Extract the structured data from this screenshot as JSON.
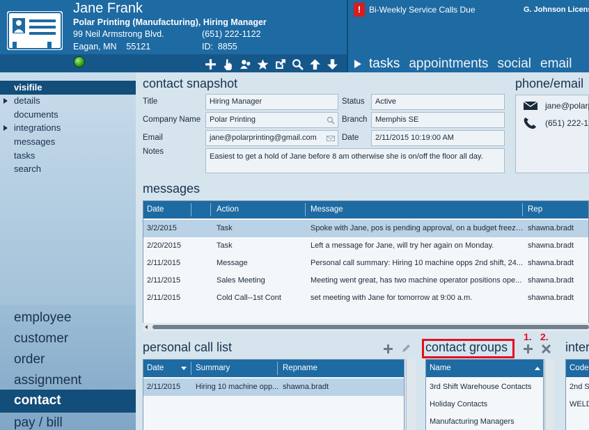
{
  "header": {
    "contact_name": "Jane Frank",
    "company_title": "Polar Printing (Manufacturing), Hiring Manager",
    "address_line1": "99 Neil Armstrong Blvd.",
    "phone": "(651) 222-1122",
    "address_line2": "Eagan, MN    55121",
    "id_text": "ID:  8855",
    "alert_badge": "!",
    "alert_text": "Bi-Weekly Service Calls Due",
    "user_name": "G. Johnson Licens",
    "nav_tabs": [
      "tasks",
      "appointments",
      "social",
      "email"
    ],
    "tool_icons": [
      "plus-icon",
      "pointer-hand-icon",
      "group-add-icon",
      "star-icon",
      "open-external-icon",
      "search-icon",
      "arrow-up-icon",
      "arrow-down-icon"
    ]
  },
  "sidebar": {
    "items": [
      {
        "label": "visifile",
        "active": true,
        "expandable": false
      },
      {
        "label": "details",
        "active": false,
        "expandable": true
      },
      {
        "label": "documents",
        "active": false,
        "expandable": false
      },
      {
        "label": "integrations",
        "active": false,
        "expandable": true
      },
      {
        "label": "messages",
        "active": false,
        "expandable": false
      },
      {
        "label": "tasks",
        "active": false,
        "expandable": false
      },
      {
        "label": "search",
        "active": false,
        "expandable": false
      }
    ],
    "bottom_nav": [
      {
        "label": "employee",
        "active": false
      },
      {
        "label": "customer",
        "active": false
      },
      {
        "label": "order",
        "active": false
      },
      {
        "label": "assignment",
        "active": false
      },
      {
        "label": "contact",
        "active": true
      },
      {
        "label": "pay / bill",
        "active": false
      }
    ]
  },
  "snapshot": {
    "title": "contact snapshot",
    "fields": {
      "title_label": "Title",
      "title_value": "Hiring Manager",
      "company_label": "Company Name",
      "company_value": "Polar Printing",
      "email_label": "Email",
      "email_value": "jane@polarprinting@gmail.com",
      "notes_label": "Notes",
      "notes_value": "Easiest to get a hold of Jane before 8 am otherwise she is on/off the floor all day.",
      "status_label": "Status",
      "status_value": "Active",
      "branch_label": "Branch",
      "branch_value": "Memphis SE",
      "date_label": "Date",
      "date_value": "2/11/2015 10:19:00 AM"
    }
  },
  "phone_email": {
    "title": "phone/email",
    "email": "jane@polarp",
    "phone": "(651) 222-1"
  },
  "messages": {
    "title": "messages",
    "columns": [
      "Date",
      "Action",
      "Message",
      "Rep"
    ],
    "rows": [
      {
        "date": "3/2/2015",
        "action": "Task",
        "message": "Spoke with Jane, pos is pending approval, on a budget freeze,...",
        "rep": "shawna.bradt",
        "selected": true
      },
      {
        "date": "2/20/2015",
        "action": "Task",
        "message": "Left a message for Jane, will try her again on Monday.",
        "rep": "shawna.bradt",
        "selected": false
      },
      {
        "date": "2/11/2015",
        "action": "Message",
        "message": "Personal call summary: Hiring 10 machine opps 2nd shift, 24...",
        "rep": "shawna.bradt",
        "selected": false
      },
      {
        "date": "2/11/2015",
        "action": "Sales Meeting",
        "message": "Meeting went great, has two machine operator positions ope...",
        "rep": "shawna.bradt",
        "selected": false
      },
      {
        "date": "2/11/2015",
        "action": "Cold Call--1st Cont",
        "message": "set meeting with Jane for tomorrow at 9:00 a.m.",
        "rep": "shawna.bradt",
        "selected": false
      }
    ]
  },
  "personal_call_list": {
    "title": "personal call list",
    "columns": [
      "Date",
      "Summary",
      "Repname"
    ],
    "rows": [
      {
        "date": "2/11/2015",
        "summary": "Hiring 10 machine opp...",
        "repname": "shawna.bradt",
        "selected": true
      }
    ]
  },
  "contact_groups": {
    "title": "contact groups",
    "column": "Name",
    "annotation_add": "1.",
    "annotation_remove": "2.",
    "rows": [
      "3rd Shift Warehouse Contacts",
      "Holiday Contacts",
      "Manufacturing Managers"
    ]
  },
  "interests": {
    "title": "inter",
    "column": "Code",
    "rows": [
      "2nd Sh",
      "WELD"
    ]
  },
  "colors": {
    "header_blue": "#1e6aa3",
    "active_nav": "#134d79",
    "alert_red": "#d91c1c",
    "annotation_red": "#e30f1f"
  }
}
